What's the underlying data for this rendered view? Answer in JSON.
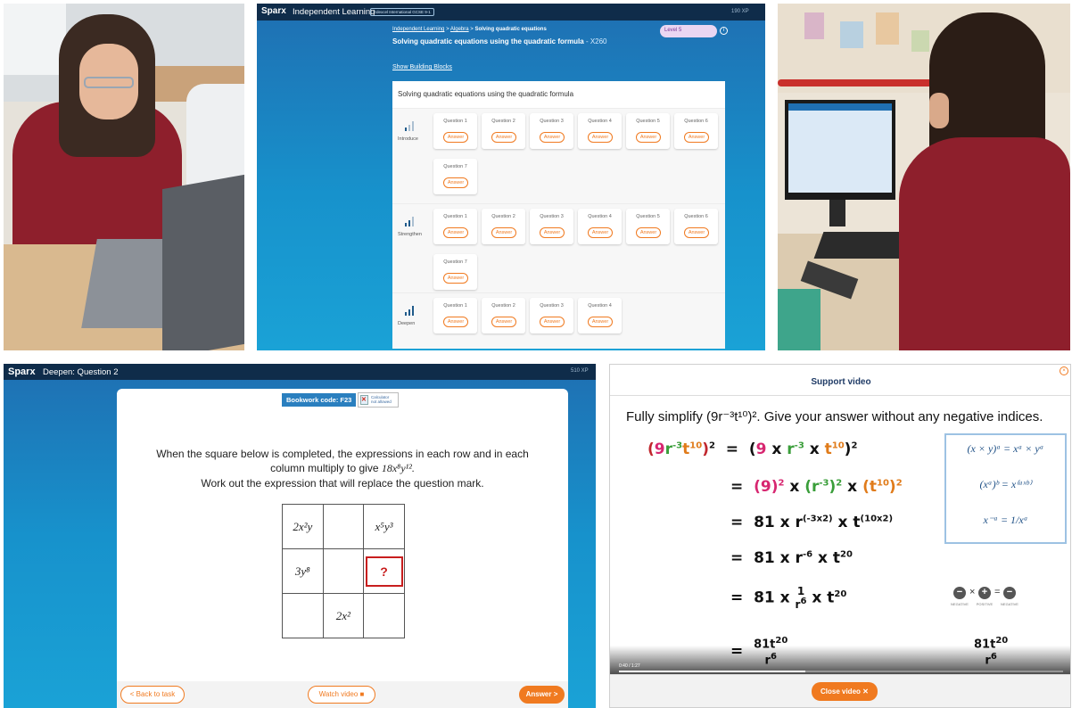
{
  "sparx_top": {
    "brand": "Sparx",
    "title": "Independent Learning",
    "pill": "Edexcel International GCSE 9-1",
    "xp": "190 XP",
    "breadcrumb": {
      "home": "Independent Learning",
      "sep1": ">",
      "topic": "Algebra",
      "sep2": ">",
      "current": "Solving quadratic equations"
    },
    "task_title": "Solving quadratic equations using the quadratic formula",
    "task_code": "- X260",
    "level": "Level 5",
    "building_blocks_link": "Show Building Blocks",
    "panel_heading": "Solving quadratic equations using the quadratic formula",
    "sections": [
      {
        "label": "Introduce",
        "questions": [
          "Question 1",
          "Question 2",
          "Question 3",
          "Question 4",
          "Question 5",
          "Question 6",
          "Question 7"
        ]
      },
      {
        "label": "Strengthen",
        "questions": [
          "Question 1",
          "Question 2",
          "Question 3",
          "Question 4",
          "Question 5",
          "Question 6",
          "Question 7"
        ]
      },
      {
        "label": "Deepen",
        "questions": [
          "Question 1",
          "Question 2",
          "Question 3",
          "Question 4"
        ]
      }
    ],
    "answer_label": "Answer"
  },
  "sparx_bottom": {
    "brand": "Sparx",
    "title": "Deepen: Question 2",
    "xp": "510 XP",
    "bookwork": "Bookwork code: F23",
    "calculator": [
      "Calculator",
      "not allowed"
    ],
    "question_line1": "When the square below is completed, the expressions in each row and in each",
    "question_line2_pre": "column multiply to give ",
    "question_line2_math": "18x⁸y¹².",
    "question_line3": "Work out the expression that will replace the question mark.",
    "grid": [
      [
        "2x²y",
        "",
        "x⁵y³"
      ],
      [
        "3y⁸",
        "",
        "?"
      ],
      [
        "",
        "2x²",
        ""
      ]
    ],
    "back_button": "< Back to task",
    "watch_button": "Watch video ■",
    "answer_button": "Answer >"
  },
  "support_video": {
    "title": "Support video",
    "close_x": "×",
    "prompt": "Fully simplify (9r⁻³t¹⁰)².  Give your answer without any negative indices.",
    "rules": [
      "(x × y)ᵃ = xᵃ × yᵃ",
      "(xᵃ)ᵇ = x⁽ᵃˣᵇ⁾",
      "x⁻ᵃ = 1/xᵃ"
    ],
    "signs": {
      "neg": "−",
      "times": "×",
      "pos": "+",
      "eq": "=",
      "labels": [
        "NEGATIVE",
        "POSITIVE",
        "NEGATIVE"
      ]
    },
    "time": "0:40 / 1:27",
    "progress": 0.42,
    "close_button": "Close video ✕"
  },
  "colors": {
    "sparx_navy": "#0f2c4a",
    "sparx_blue": "#1792cc",
    "accent_orange": "#f07a20",
    "error_red": "#c81e1e"
  }
}
